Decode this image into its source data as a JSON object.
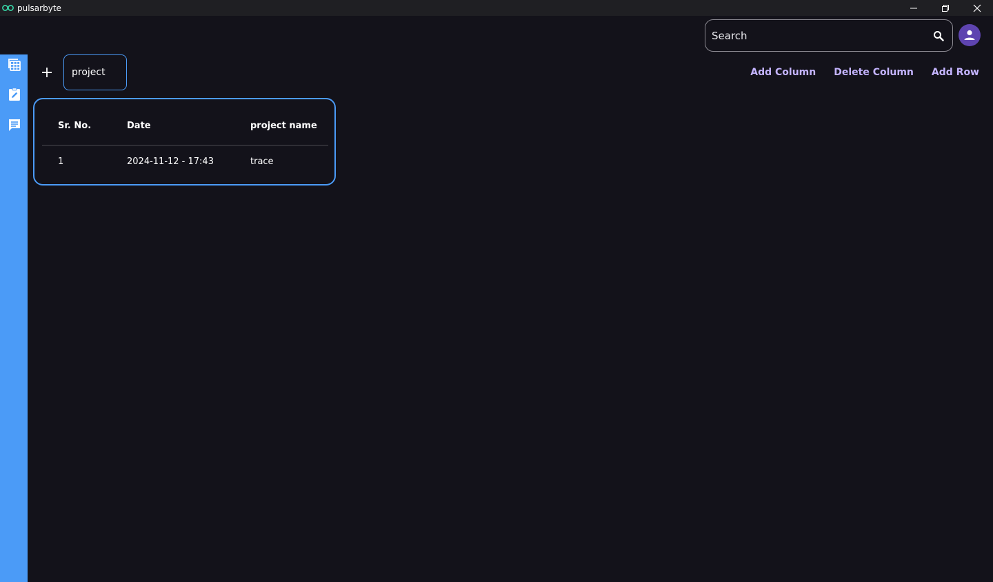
{
  "window": {
    "title": "pulsarbyte"
  },
  "search": {
    "placeholder": "Search"
  },
  "tabs": [
    {
      "label": "project"
    }
  ],
  "actions": {
    "add_column": "Add Column",
    "delete_column": "Delete Column",
    "add_row": "Add Row"
  },
  "table": {
    "headers": [
      "Sr. No.",
      "Date",
      "project name"
    ],
    "rows": [
      [
        "1",
        "2024-11-12 - 17:43",
        "trace"
      ]
    ]
  },
  "sidebar": {
    "items": [
      {
        "icon": "table-icon"
      },
      {
        "icon": "edit-note-icon"
      },
      {
        "icon": "chat-icon"
      }
    ]
  },
  "colors": {
    "accent": "#4b9bf7",
    "action_text": "#c4b4ff",
    "avatar": "#5e44b0",
    "background": "#13121a"
  }
}
